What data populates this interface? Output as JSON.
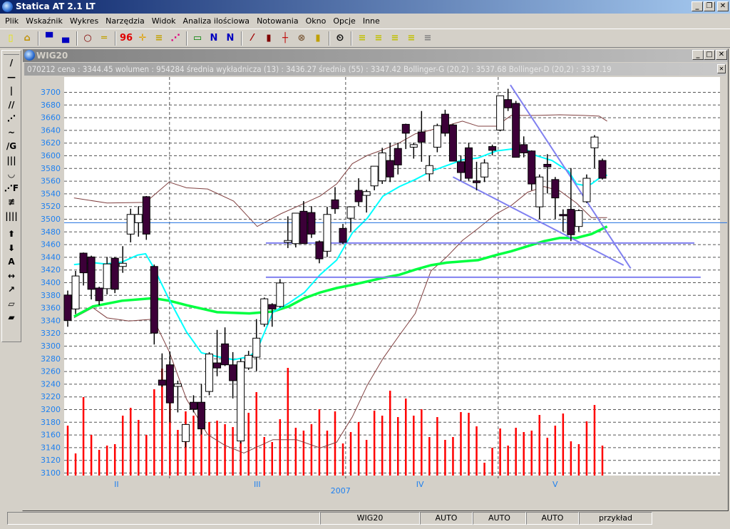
{
  "app": {
    "title": "Statica AT 2.1 LT"
  },
  "menu": [
    "Plik",
    "Wskaźnik",
    "Wykres",
    "Narzędzia",
    "Widok",
    "Analiza ilościowa",
    "Notowania",
    "Okno",
    "Opcje",
    "Inne"
  ],
  "toolbar": [
    {
      "icon": "new-file-icon",
      "glyph": "▯",
      "color": "#e8e800"
    },
    {
      "icon": "open-folder-icon",
      "glyph": "⌂",
      "color": "#c09000"
    },
    "sep",
    {
      "icon": "chart-window-icon",
      "glyph": "▀",
      "color": "#0000c0"
    },
    {
      "icon": "chart-window-alt-icon",
      "glyph": "▄",
      "color": "#0000c0"
    },
    "sep",
    {
      "icon": "zoom-icon",
      "glyph": "○",
      "color": "#800000"
    },
    {
      "icon": "ruler-icon",
      "glyph": "═",
      "color": "#c0a000"
    },
    "sep",
    {
      "icon": "numbers-icon",
      "glyph": "96",
      "color": "#e00000"
    },
    {
      "icon": "crosshair-icon",
      "glyph": "✛",
      "color": "#e0a000"
    },
    {
      "icon": "lines-icon",
      "glyph": "≡",
      "color": "#c0a000"
    },
    {
      "icon": "multi-chart-icon",
      "glyph": "⋰",
      "color": "#e00080"
    },
    "sep",
    {
      "icon": "chart-frame-icon",
      "glyph": "▭",
      "color": "#008000"
    },
    {
      "icon": "chart-frame-2-icon",
      "glyph": "N",
      "color": "#0000c0"
    },
    {
      "icon": "chart-frame-3-icon",
      "glyph": "N",
      "color": "#0000c0"
    },
    "sep",
    {
      "icon": "line-chart-icon",
      "glyph": "⁄",
      "color": "#a00000"
    },
    {
      "icon": "bar-chart-icon",
      "glyph": "▮",
      "color": "#800000"
    },
    {
      "icon": "ohlc-icon",
      "glyph": "┼",
      "color": "#c00000"
    },
    {
      "icon": "cancel-icon",
      "glyph": "⊗",
      "color": "#806040"
    },
    {
      "icon": "candlestick-icon",
      "glyph": "▮",
      "color": "#c0a000"
    },
    "sep",
    {
      "icon": "alarm-clock-icon",
      "glyph": "⏲",
      "color": "#000"
    },
    "sep",
    {
      "icon": "level-1-icon",
      "glyph": "≡",
      "color": "#c0c000"
    },
    {
      "icon": "level-2-icon",
      "glyph": "≡",
      "color": "#c0c000"
    },
    {
      "icon": "level-3-icon",
      "glyph": "≡",
      "color": "#c0c000"
    },
    {
      "icon": "level-4-icon",
      "glyph": "≡",
      "color": "#c0c000"
    },
    {
      "icon": "level-5-icon",
      "glyph": "≡",
      "color": "#808080"
    }
  ],
  "left_tools": [
    {
      "icon": "trend-line-icon",
      "glyph": "/"
    },
    {
      "icon": "horizontal-line-icon",
      "glyph": "—"
    },
    {
      "icon": "vertical-line-icon",
      "glyph": "|"
    },
    {
      "icon": "parallel-lines-icon",
      "glyph": "//"
    },
    {
      "icon": "fan-icon",
      "glyph": "⋰"
    },
    {
      "icon": "zigzag-icon",
      "glyph": "~"
    },
    {
      "icon": "gann-line-icon",
      "glyph": "/G"
    },
    {
      "icon": "vertical-lines-icon",
      "glyph": "|||"
    },
    {
      "icon": "arcs-icon",
      "glyph": "◡"
    },
    {
      "icon": "fibonacci-fan-icon",
      "glyph": "⋰F"
    },
    {
      "icon": "channel-icon",
      "glyph": "≢"
    },
    {
      "icon": "time-zones-icon",
      "glyph": "||||"
    },
    {
      "icon": "arrow-up-icon",
      "glyph": "⬆"
    },
    {
      "icon": "arrow-down-icon",
      "glyph": "⬇"
    },
    {
      "icon": "text-icon",
      "glyph": "A"
    },
    {
      "icon": "move-icon",
      "glyph": "↔"
    },
    {
      "icon": "resize-icon",
      "glyph": "↗"
    },
    {
      "icon": "eraser-icon",
      "glyph": "▱"
    },
    {
      "icon": "eraser-all-icon",
      "glyph": "▰"
    }
  ],
  "child": {
    "title": "WIG20",
    "info": "070212  cena : 3344.45 wolumen : 954284 średnia wykładnicza (13) : 3436.27 średnia (55) : 3347.42 Bollinger-G (20,2) : 3537.68 Bollinger-D (20,2) : 3337.19"
  },
  "status": {
    "instrument": "WIG20",
    "mode1": "AUTO",
    "mode2": "AUTO",
    "mode3": "AUTO",
    "profile": "przykład"
  },
  "colors": {
    "up": "#ffffff",
    "down": "#3c0038",
    "volume": "#ff0000",
    "ema": "#00ffff",
    "sma": "#00ff40",
    "bollinger": "#804040",
    "trendline": "#8080f0",
    "cursor": "#2070e0",
    "axis_text": "#1e80f0"
  },
  "chart_data": {
    "type": "candlestick",
    "title": "WIG20",
    "ylim": [
      3100,
      3700
    ],
    "yticks": [
      3700,
      3680,
      3660,
      3640,
      3620,
      3600,
      3580,
      3560,
      3540,
      3520,
      3500,
      3480,
      3460,
      3440,
      3420,
      3400,
      3380,
      3360,
      3340,
      3320,
      3300,
      3280,
      3260,
      3240,
      3220,
      3200,
      3180,
      3160,
      3140,
      3120,
      3100
    ],
    "xlabels": [
      {
        "label": "II",
        "at": 6.2
      },
      {
        "label": "III",
        "at": 24.1
      },
      {
        "label": "2007",
        "at": 34.7,
        "row": 2
      },
      {
        "label": "IV",
        "at": 44.8
      },
      {
        "label": "V",
        "at": 62
      }
    ],
    "month_separators": [
      12.9,
      35.3,
      54.7
    ],
    "ohlc": [
      [
        3380,
        3387,
        3330,
        3340
      ],
      [
        3358,
        3418,
        3350,
        3410
      ],
      [
        3446,
        3447,
        3395,
        3415
      ],
      [
        3440,
        3442,
        3373,
        3389
      ],
      [
        3391,
        3393,
        3364,
        3371
      ],
      [
        3390,
        3440,
        3381,
        3429
      ],
      [
        3438,
        3440,
        3383,
        3389
      ],
      [
        3425,
        3457,
        3415,
        3430
      ],
      [
        3476,
        3516,
        3463,
        3507
      ],
      [
        3494,
        3520,
        3472,
        3507
      ],
      [
        3535,
        3536,
        3467,
        3476
      ],
      [
        3425,
        3428,
        3302,
        3320
      ],
      [
        3246,
        3288,
        3235,
        3238
      ],
      [
        3270,
        3291,
        3179,
        3210
      ],
      [
        3236,
        3245,
        3195,
        3240
      ],
      [
        3149,
        3176,
        3140,
        3176
      ],
      [
        3211,
        3222,
        3195,
        3200
      ],
      [
        3211,
        3240,
        3160,
        3169
      ],
      [
        3228,
        3290,
        3222,
        3287
      ],
      [
        3273,
        3325,
        3252,
        3265
      ],
      [
        3303,
        3329,
        3268,
        3270
      ],
      [
        3270,
        3290,
        3217,
        3245
      ],
      [
        3150,
        3280,
        3146,
        3275
      ],
      [
        3265,
        3292,
        3262,
        3285
      ],
      [
        3282,
        3342,
        3260,
        3312
      ],
      [
        3334,
        3376,
        3330,
        3374
      ],
      [
        3365,
        3367,
        3330,
        3358
      ],
      [
        3362,
        3405,
        3360,
        3399
      ],
      [
        3463,
        3504,
        3454,
        3466
      ],
      [
        3461,
        3509,
        3455,
        3509
      ],
      [
        3512,
        3528,
        3461,
        3461
      ],
      [
        3510,
        3520,
        3470,
        3476
      ],
      [
        3464,
        3466,
        3430,
        3437
      ],
      [
        3449,
        3519,
        3440,
        3507
      ],
      [
        3530,
        3550,
        3508,
        3516
      ],
      [
        3485,
        3492,
        3460,
        3463
      ],
      [
        3501,
        3519,
        3480,
        3519
      ],
      [
        3545,
        3564,
        3520,
        3527
      ],
      [
        3537,
        3546,
        3510,
        3543
      ],
      [
        3552,
        3583,
        3545,
        3583
      ],
      [
        3560,
        3612,
        3555,
        3604
      ],
      [
        3592,
        3620,
        3558,
        3566
      ],
      [
        3611,
        3620,
        3570,
        3585
      ],
      [
        3649,
        3650,
        3610,
        3635
      ],
      [
        3613,
        3620,
        3595,
        3617
      ],
      [
        3637,
        3670,
        3590,
        3621
      ],
      [
        3571,
        3600,
        3560,
        3584
      ],
      [
        3613,
        3650,
        3605,
        3647
      ],
      [
        3665,
        3672,
        3630,
        3635
      ],
      [
        3648,
        3650,
        3591,
        3591
      ],
      [
        3590,
        3600,
        3560,
        3573
      ],
      [
        3612,
        3620,
        3560,
        3564
      ],
      [
        3560,
        3590,
        3545,
        3557
      ],
      [
        3566,
        3594,
        3558,
        3588
      ],
      [
        3614,
        3617,
        3600,
        3608
      ],
      [
        3640,
        3694,
        3638,
        3694
      ],
      [
        3688,
        3705,
        3670,
        3675
      ],
      [
        3682,
        3686,
        3597,
        3597
      ],
      [
        3617,
        3630,
        3597,
        3604
      ],
      [
        3607,
        3608,
        3545,
        3555
      ],
      [
        3519,
        3570,
        3500,
        3566
      ],
      [
        3586,
        3602,
        3540,
        3582
      ],
      [
        3562,
        3566,
        3500,
        3533
      ],
      [
        3507,
        3515,
        3480,
        3505
      ],
      [
        3515,
        3580,
        3465,
        3475
      ],
      [
        3488,
        3515,
        3480,
        3513
      ],
      [
        3527,
        3570,
        3525,
        3564
      ],
      [
        3612,
        3632,
        3580,
        3629
      ],
      [
        3592,
        3595,
        3562,
        3564
      ]
    ],
    "volume_k": [
      700,
      310,
      1100,
      570,
      360,
      420,
      440,
      840,
      950,
      780,
      570,
      1210,
      1500,
      1220,
      640,
      900,
      840,
      670,
      750,
      770,
      720,
      680,
      470,
      880,
      1170,
      540,
      470,
      790,
      1510,
      670,
      630,
      720,
      930,
      630,
      900,
      450,
      610,
      750,
      500,
      910,
      840,
      1190,
      820,
      1080,
      840,
      930,
      540,
      820,
      500,
      540,
      890,
      880,
      690,
      180,
      390,
      660,
      420,
      670,
      610,
      630,
      850,
      530,
      700,
      870,
      480,
      440,
      760,
      990,
      420
    ],
    "ema13": [
      [
        0.8,
        3428
      ],
      [
        3.2,
        3431
      ],
      [
        4.8,
        3429
      ],
      [
        6.9,
        3432
      ],
      [
        8.9,
        3443
      ],
      [
        9.9,
        3445
      ],
      [
        10.9,
        3424
      ],
      [
        12.9,
        3373
      ],
      [
        15.1,
        3322
      ],
      [
        17,
        3289
      ],
      [
        19,
        3283
      ],
      [
        21.1,
        3278
      ],
      [
        23.1,
        3283
      ],
      [
        24.1,
        3294
      ],
      [
        26.1,
        3353
      ],
      [
        28.1,
        3367
      ],
      [
        30.1,
        3384
      ],
      [
        32.1,
        3412
      ],
      [
        34.2,
        3435
      ],
      [
        36.2,
        3478
      ],
      [
        38.1,
        3501
      ],
      [
        40.1,
        3536
      ],
      [
        42.2,
        3551
      ],
      [
        44.2,
        3562
      ],
      [
        46.2,
        3575
      ],
      [
        48.2,
        3584
      ],
      [
        50.2,
        3593
      ],
      [
        52.2,
        3596
      ],
      [
        54.5,
        3607
      ],
      [
        56.4,
        3610
      ],
      [
        58.5,
        3608
      ],
      [
        59.5,
        3600
      ],
      [
        61.6,
        3592
      ],
      [
        63.7,
        3575
      ],
      [
        64.7,
        3555
      ],
      [
        65.6,
        3553
      ],
      [
        66.6,
        3555
      ],
      [
        67.6,
        3564
      ],
      [
        68.6,
        3569
      ]
    ],
    "sma55": [
      [
        0.8,
        3346
      ],
      [
        3.2,
        3362
      ],
      [
        6.9,
        3371
      ],
      [
        10.9,
        3375
      ],
      [
        12.9,
        3371
      ],
      [
        15.1,
        3364
      ],
      [
        19,
        3353
      ],
      [
        23.1,
        3351
      ],
      [
        26.1,
        3354
      ],
      [
        28.1,
        3362
      ],
      [
        30.1,
        3375
      ],
      [
        32.1,
        3384
      ],
      [
        34.2,
        3391
      ],
      [
        36.2,
        3396
      ],
      [
        40.1,
        3407
      ],
      [
        42.2,
        3412
      ],
      [
        44.2,
        3420
      ],
      [
        46.2,
        3427
      ],
      [
        48.2,
        3431
      ],
      [
        52.2,
        3435
      ],
      [
        54.5,
        3443
      ],
      [
        56.4,
        3449
      ],
      [
        58.5,
        3457
      ],
      [
        60.6,
        3465
      ],
      [
        62.6,
        3470
      ],
      [
        64.7,
        3470
      ],
      [
        66.6,
        3476
      ],
      [
        68.6,
        3488
      ]
    ],
    "bollinger_upper": [
      [
        0.8,
        3533
      ],
      [
        5,
        3525
      ],
      [
        9.9,
        3526
      ],
      [
        12.9,
        3558
      ],
      [
        15.1,
        3549
      ],
      [
        17.8,
        3547
      ],
      [
        21.1,
        3528
      ],
      [
        24.1,
        3488
      ],
      [
        27.1,
        3508
      ],
      [
        29.1,
        3519
      ],
      [
        32.1,
        3536
      ],
      [
        34.2,
        3555
      ],
      [
        36.2,
        3587
      ],
      [
        38.1,
        3600
      ],
      [
        40.1,
        3609
      ],
      [
        42.2,
        3620
      ],
      [
        44.2,
        3634
      ],
      [
        46.2,
        3640
      ],
      [
        48.2,
        3647
      ],
      [
        50.2,
        3654
      ],
      [
        52.2,
        3646
      ],
      [
        54.5,
        3646
      ],
      [
        56.4,
        3663
      ],
      [
        59.5,
        3663
      ],
      [
        62.6,
        3664
      ],
      [
        65.6,
        3663
      ],
      [
        67.6,
        3662
      ],
      [
        68.6,
        3654
      ]
    ],
    "bollinger_lower": [
      [
        0.8,
        3344
      ],
      [
        3.2,
        3360
      ],
      [
        5,
        3344
      ],
      [
        7.8,
        3339
      ],
      [
        10.9,
        3342
      ],
      [
        12.9,
        3291
      ],
      [
        15.1,
        3216
      ],
      [
        17.8,
        3160
      ],
      [
        20,
        3143
      ],
      [
        22.4,
        3131
      ],
      [
        26.1,
        3152
      ],
      [
        29.1,
        3152
      ],
      [
        32.1,
        3139
      ],
      [
        34.2,
        3148
      ],
      [
        36.2,
        3188
      ],
      [
        38.1,
        3238
      ],
      [
        40.1,
        3280
      ],
      [
        42.2,
        3317
      ],
      [
        44.2,
        3351
      ],
      [
        46.2,
        3418
      ],
      [
        48.2,
        3440
      ],
      [
        50.2,
        3466
      ],
      [
        52.2,
        3485
      ],
      [
        54.5,
        3508
      ],
      [
        56.4,
        3521
      ],
      [
        58.5,
        3542
      ],
      [
        60.6,
        3551
      ],
      [
        62.6,
        3544
      ],
      [
        64.7,
        3525
      ],
      [
        66.6,
        3502
      ],
      [
        68.6,
        3502
      ]
    ],
    "trendlines": [
      {
        "from": [
          25.2,
          3462
        ],
        "to": [
          79.7,
          3462
        ]
      },
      {
        "from": [
          25.2,
          3408
        ],
        "to": [
          80.5,
          3408
        ]
      },
      {
        "from": [
          56.3,
          3711
        ],
        "to": [
          71.6,
          3422
        ]
      },
      {
        "from": [
          49,
          3566
        ],
        "to": [
          70.7,
          3427
        ]
      }
    ],
    "cursor_level": 3494
  }
}
